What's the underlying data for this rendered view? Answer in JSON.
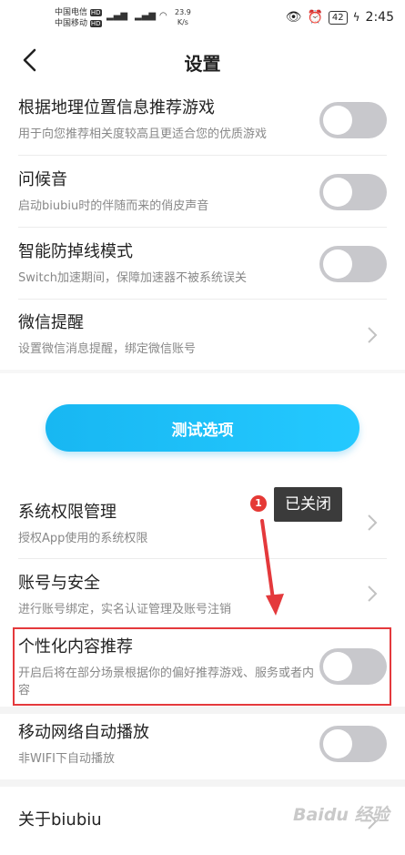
{
  "status_bar": {
    "carrier1": "中国电信",
    "carrier2": "中国移动",
    "hd": "HD",
    "signal_label": "4G",
    "net_speed_value": "23.9",
    "net_speed_unit": "K/s",
    "battery": "42",
    "time": "2:45"
  },
  "header": {
    "title": "设置"
  },
  "settings": [
    {
      "title": "根据地理位置信息推荐游戏",
      "desc": "用于向您推荐相关度较高且更适合您的优质游戏",
      "control": "toggle",
      "state": "off"
    },
    {
      "title": "问候音",
      "desc": "启动biubiu时的伴随而来的俏皮声音",
      "control": "toggle",
      "state": "off"
    },
    {
      "title": "智能防掉线模式",
      "desc": "Switch加速期间，保障加速器不被系统误关",
      "control": "toggle",
      "state": "off"
    },
    {
      "title": "微信提醒",
      "desc": "设置微信消息提醒，绑定微信账号",
      "control": "chevron"
    }
  ],
  "test_button": {
    "label": "测试选项"
  },
  "settings2": [
    {
      "title": "系统权限管理",
      "desc": "授权App使用的系统权限",
      "control": "chevron"
    },
    {
      "title": "账号与安全",
      "desc": "进行账号绑定，实名认证管理及账号注销",
      "control": "chevron"
    },
    {
      "title": "个性化内容推荐",
      "desc": "开启后将在部分场景根据你的偏好推荐游戏、服务或者内容",
      "control": "toggle",
      "state": "off"
    },
    {
      "title": "移动网络自动播放",
      "desc": "非WIFI下自动播放",
      "control": "toggle",
      "state": "off"
    }
  ],
  "about": {
    "title": "关于biubiu"
  },
  "annotation": {
    "badge": "1",
    "tooltip": "已关闭",
    "highlight_color": "#e4393c"
  },
  "watermark": "Baidu 经验",
  "colors": {
    "accent": "#1ebdf5",
    "toggle_off": "#c8c8cc"
  }
}
